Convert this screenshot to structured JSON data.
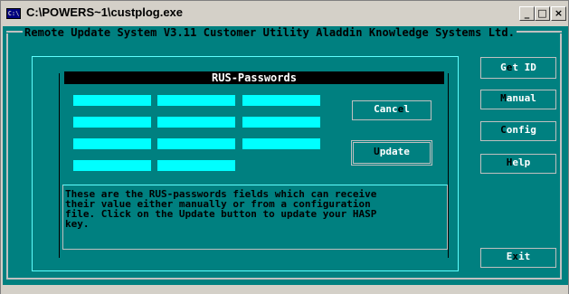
{
  "window": {
    "title": "C:\\POWERS~1\\custplog.exe",
    "icon_label": "C:\\"
  },
  "controls": {
    "minimize": "_",
    "maximize": "□",
    "close": "×"
  },
  "header": {
    "text": "Remote Update System V3.11 Customer Utility  Aladdin Knowledge Systems Ltd."
  },
  "passwords": {
    "title": "RUS-Passwords",
    "fields": [
      "",
      "",
      "",
      "",
      "",
      "",
      "",
      "",
      "",
      "",
      ""
    ]
  },
  "buttons": {
    "cancel": {
      "before": "Canc",
      "hotkey": "e",
      "after": "l"
    },
    "update": {
      "before": "",
      "hotkey": "U",
      "after": "pdate"
    },
    "get_id": {
      "before": "G",
      "hotkey": "e",
      "after": "t ID"
    },
    "manual": {
      "before": "",
      "hotkey": "M",
      "after": "anual"
    },
    "config": {
      "before": "",
      "hotkey": "C",
      "after": "onfig"
    },
    "help": {
      "before": "",
      "hotkey": "H",
      "after": "elp"
    },
    "exit": {
      "before": "E",
      "hotkey": "x",
      "after": "it"
    }
  },
  "info": {
    "text": "These are the RUS-passwords fields which can receive\ntheir value either manually or from a configuration\nfile. Click on the Update button to update your HASP\nkey."
  }
}
